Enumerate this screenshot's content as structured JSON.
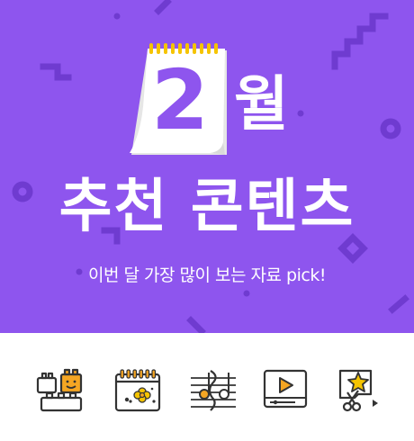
{
  "banner": {
    "month_number": "2",
    "month_suffix": "월",
    "headline": "추천 콘텐츠",
    "subtitle": "이번 달 가장 많이 보는 자료 pick!",
    "colors": {
      "background": "#8e55ee",
      "decoration": "#6f3bd0",
      "calendar_ring": "#f5c400",
      "text": "#ffffff"
    }
  },
  "icons": [
    {
      "name": "blocks-icon"
    },
    {
      "name": "calendar-flower-icon"
    },
    {
      "name": "music-notes-icon"
    },
    {
      "name": "video-play-icon"
    },
    {
      "name": "star-craft-icon"
    }
  ]
}
